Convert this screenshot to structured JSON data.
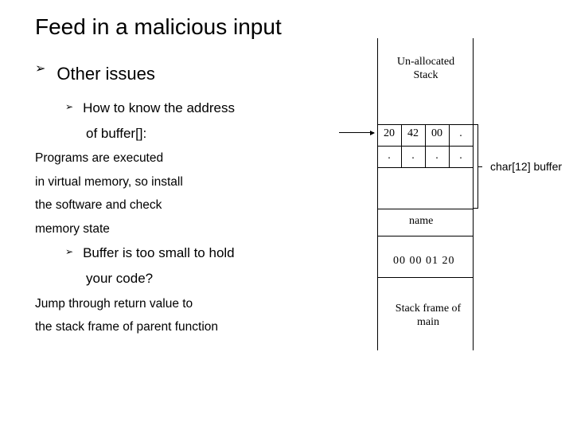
{
  "title": "Feed in a malicious input",
  "bullets": {
    "l1": "Other issues",
    "l2a": "How to know the address",
    "l2a_cont": "of buffer[]:",
    "para1_lines": [
      "Programs are executed",
      "in virtual memory, so install",
      "the software and check",
      "memory state"
    ],
    "l2b": "Buffer is too small to hold",
    "l2b_cont": "your code?",
    "para2_lines": [
      "Jump through return value to",
      "the stack frame of parent function"
    ]
  },
  "diagram": {
    "unallocated": "Un-allocated\nStack",
    "cells_row1": [
      "20",
      "42",
      "00",
      "."
    ],
    "cells_row2": [
      ".",
      ".",
      ".",
      "."
    ],
    "name_label": "name",
    "ret_value": "00 00 01 20",
    "stack_frame": "Stack frame of\nmain",
    "buffer_label": "char[12] buffer"
  },
  "glyph": "➢"
}
